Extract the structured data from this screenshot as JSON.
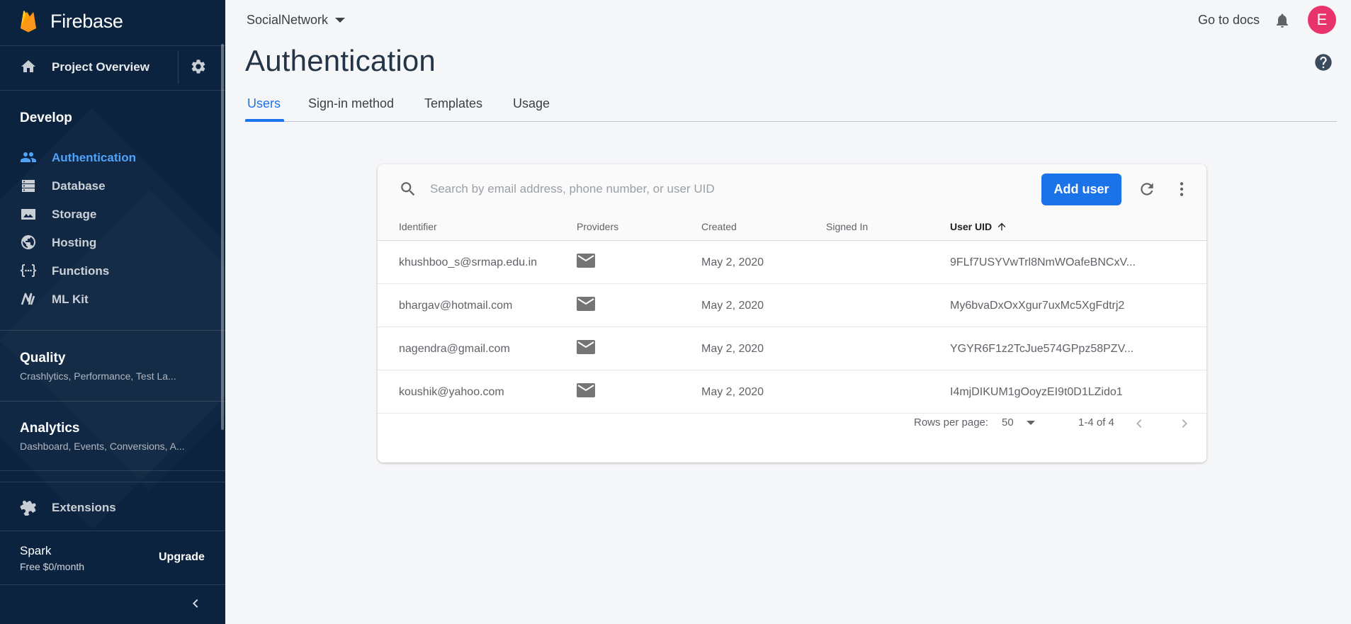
{
  "sidebar": {
    "brand": "Firebase",
    "overview_label": "Project Overview",
    "develop_title": "Develop",
    "develop_items": [
      {
        "label": "Authentication",
        "icon": "people-icon",
        "active": true
      },
      {
        "label": "Database",
        "icon": "database-icon"
      },
      {
        "label": "Storage",
        "icon": "image-icon"
      },
      {
        "label": "Hosting",
        "icon": "globe-icon"
      },
      {
        "label": "Functions",
        "icon": "functions-icon"
      },
      {
        "label": "ML Kit",
        "icon": "ml-kit-icon"
      }
    ],
    "quality": {
      "title": "Quality",
      "subtitle": "Crashlytics, Performance, Test La..."
    },
    "analytics": {
      "title": "Analytics",
      "subtitle": "Dashboard, Events, Conversions, A..."
    },
    "extensions_label": "Extensions",
    "plan": {
      "name": "Spark",
      "price": "Free $0/month",
      "upgrade": "Upgrade"
    }
  },
  "header": {
    "project": "SocialNetwork",
    "docs_link": "Go to docs",
    "avatar_letter": "E"
  },
  "page": {
    "title": "Authentication",
    "tabs": [
      "Users",
      "Sign-in method",
      "Templates",
      "Usage"
    ],
    "active_tab": "Users"
  },
  "users_table": {
    "search_placeholder": "Search by email address, phone number, or user UID",
    "add_user_label": "Add user",
    "columns": [
      "Identifier",
      "Providers",
      "Created",
      "Signed In",
      "User UID"
    ],
    "sorted_column": "User UID",
    "rows": [
      {
        "identifier": "khushboo_s@srmap.edu.in",
        "provider": "email-icon",
        "created": "May 2, 2020",
        "signed_in": "",
        "uid": "9FLf7USYVwTrl8NmWOafeBNCxV..."
      },
      {
        "identifier": "bhargav@hotmail.com",
        "provider": "email-icon",
        "created": "May 2, 2020",
        "signed_in": "",
        "uid": "My6bvaDxOxXgur7uxMc5XgFdtrj2"
      },
      {
        "identifier": "nagendra@gmail.com",
        "provider": "email-icon",
        "created": "May 2, 2020",
        "signed_in": "",
        "uid": "YGYR6F1z2TcJue574GPpz58PZV..."
      },
      {
        "identifier": "koushik@yahoo.com",
        "provider": "email-icon",
        "created": "May 2, 2020",
        "signed_in": "",
        "uid": "I4mjDIKUM1gOoyzEI9t0D1LZido1"
      }
    ],
    "footer": {
      "rows_per_page_label": "Rows per page:",
      "rows_per_page": "50",
      "range": "1-4 of 4"
    }
  },
  "colors": {
    "sidebar_bg": "#0c2340",
    "accent": "#1a73e8",
    "active_nav": "#4fa3f7",
    "avatar": "#e8336d"
  }
}
